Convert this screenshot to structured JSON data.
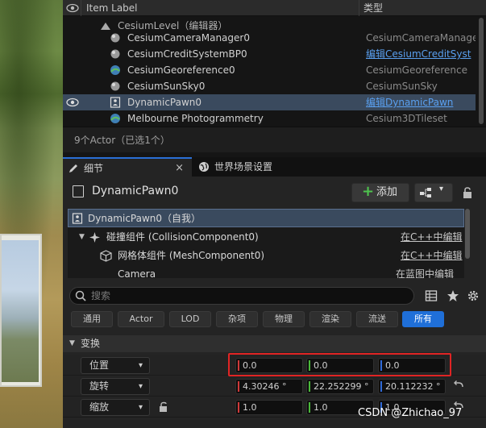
{
  "outliner": {
    "col_label": "Item Label",
    "col_type": "类型",
    "level_row": "CesiumLevel（编辑器）",
    "rows": [
      {
        "name": "CesiumCameraManager0",
        "type": "CesiumCameraManage",
        "link": false
      },
      {
        "name": "CesiumCreditSystemBP0",
        "type": "编辑CesiumCreditSyst",
        "link": true
      },
      {
        "name": "CesiumGeoreference0",
        "type": "CesiumGeoreference",
        "link": false
      },
      {
        "name": "CesiumSunSky0",
        "type": "CesiumSunSky",
        "link": false
      },
      {
        "name": "DynamicPawn0",
        "type": "编辑DynamicPawn",
        "link": true
      },
      {
        "name": "Melbourne Photogrammetry",
        "type": "Cesium3DTileset",
        "link": false
      }
    ],
    "footer": "9个Actor（已选1个）"
  },
  "tabs": {
    "details": "细节",
    "world_settings": "世界场景设置",
    "close": "×"
  },
  "details": {
    "title": "DynamicPawn0",
    "add_label": "添加",
    "components": [
      {
        "name": "DynamicPawn0（自我）",
        "link": ""
      },
      {
        "name": "碰撞组件 (CollisionComponent0)",
        "link": "在C++中编辑"
      },
      {
        "name": "网格体组件 (MeshComponent0)",
        "link": "在C++中编辑"
      },
      {
        "name": "Camera",
        "link": "在蓝图中编辑"
      }
    ],
    "search_placeholder": "搜索",
    "filters": [
      "通用",
      "Actor",
      "LOD",
      "杂项",
      "物理",
      "渲染",
      "流送",
      "所有"
    ],
    "active_filter": "所有",
    "section": "变换",
    "transform": {
      "location": {
        "label": "位置",
        "x": "0.0",
        "y": "0.0",
        "z": "0.0"
      },
      "rotation": {
        "label": "旋转",
        "x": "4.30246 °",
        "y": "22.252299 °",
        "z": "20.112232 °"
      },
      "scale": {
        "label": "缩放",
        "x": "1.0",
        "y": "1.0",
        "z": "1.0"
      }
    }
  },
  "watermark": "CSDN @Zhichao_97",
  "colors": {
    "accent": "#1f6fd8",
    "highlight": "#e02424",
    "link": "#5aa0f0"
  }
}
